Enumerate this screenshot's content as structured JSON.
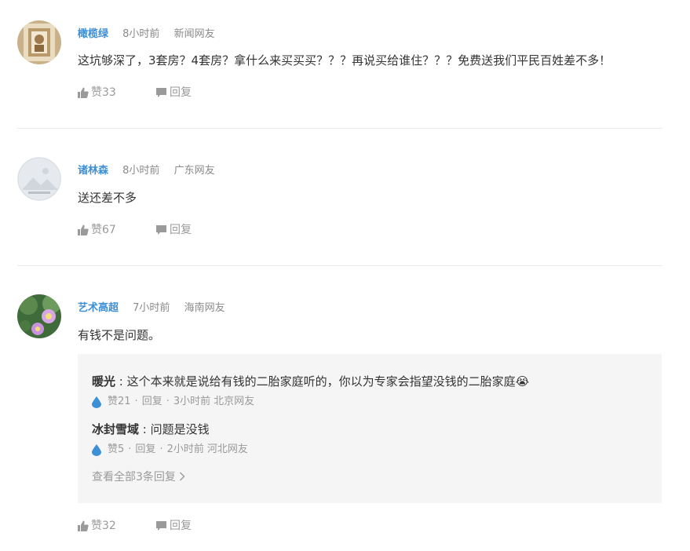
{
  "comments": [
    {
      "user": "橄榄绿",
      "time": "8小时前",
      "source": "新闻网友",
      "content": "这坑够深了，3套房？4套房？拿什么来买买买？？？再说买给谁住？？？免费送我们平民百姓差不多！",
      "like_label": "赞33",
      "reply_label": "回复"
    },
    {
      "user": "诸林森",
      "time": "8小时前",
      "source": "广东网友",
      "content": "送还差不多",
      "like_label": "赞67",
      "reply_label": "回复"
    },
    {
      "user": "艺术高超",
      "time": "7小时前",
      "source": "海南网友",
      "content": "有钱不是问题。",
      "like_label": "赞32",
      "reply_label": "回复",
      "replies": [
        {
          "user": "暖光",
          "sep": " : ",
          "text": "这个本来就是说给有钱的二胎家庭听的，你以为专家会指望没钱的二胎家庭",
          "emoji": "😭",
          "likes": "赞21",
          "reply": "回复",
          "time": "3小时前",
          "source": "北京网友"
        },
        {
          "user": "冰封雪域",
          "sep": " : ",
          "text": "问题是没钱",
          "likes": "赞5",
          "reply": "回复",
          "time": "2小时前",
          "source": "河北网友"
        }
      ],
      "view_all": "查看全部3条回复"
    }
  ],
  "colors": {
    "username": "#3d8fd6",
    "meta": "#8a8a8a",
    "reply_bg": "#f5f5f5",
    "drop": "#3d8fd6"
  },
  "icons": {
    "like": "thumbs-up-icon",
    "reply": "speech-bubble-icon",
    "reply_like": "water-drop-icon",
    "chevron": "chevron-right-icon"
  }
}
